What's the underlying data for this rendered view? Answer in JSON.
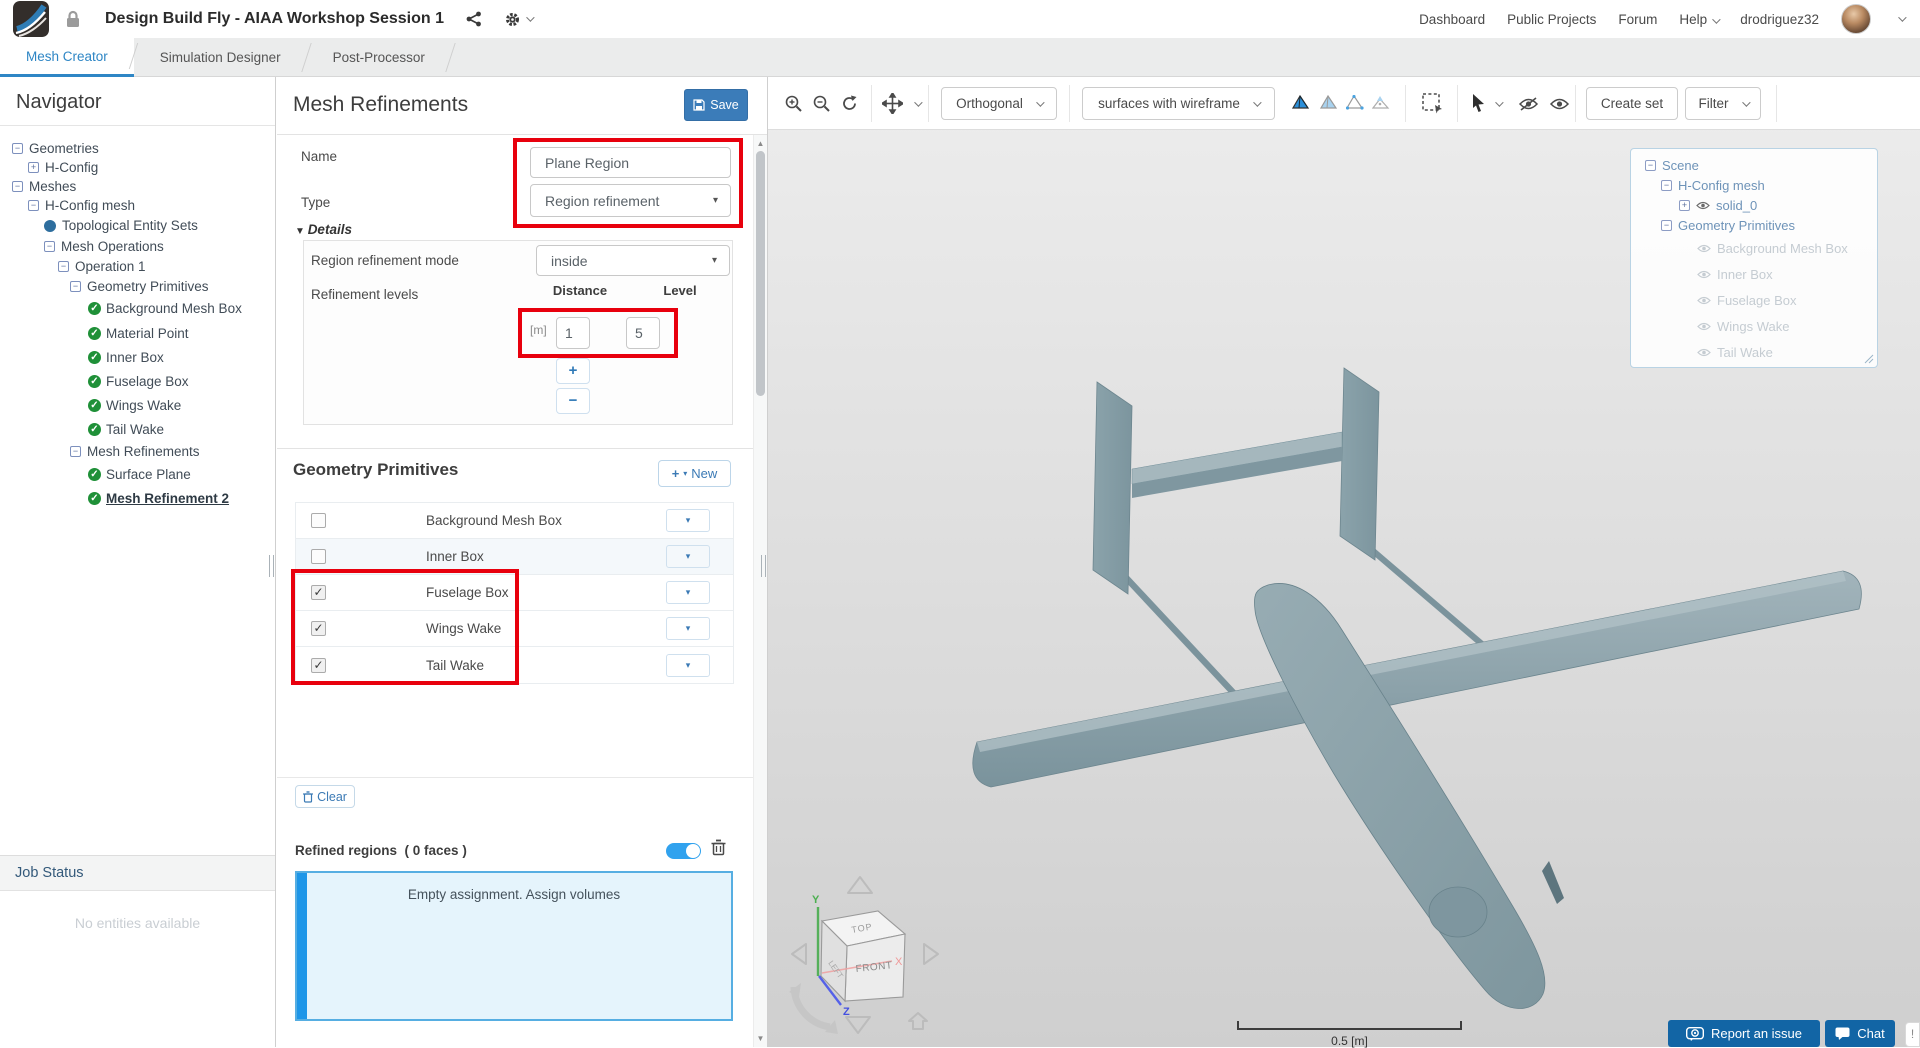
{
  "header": {
    "title": "Design Build Fly - AIAA Workshop Session 1",
    "nav": {
      "dashboard": "Dashboard",
      "public_projects": "Public Projects",
      "forum": "Forum",
      "help": "Help",
      "username": "drodriguez32"
    }
  },
  "tabs": [
    {
      "label": "Mesh Creator",
      "active": true
    },
    {
      "label": "Simulation Designer",
      "active": false
    },
    {
      "label": "Post-Processor",
      "active": false
    }
  ],
  "navigator": {
    "title": "Navigator",
    "tree": [
      {
        "label": "Geometries",
        "icon": "collapse"
      },
      {
        "label": "H-Config",
        "icon": "expand"
      },
      {
        "label": "Meshes",
        "icon": "collapse"
      },
      {
        "label": "H-Config mesh",
        "icon": "collapse"
      },
      {
        "label": "Topological Entity Sets",
        "icon": "blue-dot"
      },
      {
        "label": "Mesh Operations",
        "icon": "collapse"
      },
      {
        "label": "Operation 1",
        "icon": "collapse"
      },
      {
        "label": "Geometry Primitives",
        "icon": "collapse"
      },
      {
        "label": "Background Mesh Box",
        "icon": "check"
      },
      {
        "label": "Material Point",
        "icon": "check"
      },
      {
        "label": "Inner Box",
        "icon": "check"
      },
      {
        "label": "Fuselage Box",
        "icon": "check"
      },
      {
        "label": "Wings Wake",
        "icon": "check"
      },
      {
        "label": "Tail Wake",
        "icon": "check"
      },
      {
        "label": "Mesh Refinements",
        "icon": "collapse"
      },
      {
        "label": "Surface Plane",
        "icon": "check"
      },
      {
        "label": "Mesh Refinement 2",
        "icon": "check",
        "selected": true
      }
    ],
    "job_status": {
      "title": "Job Status",
      "empty_message": "No entities available"
    }
  },
  "panel": {
    "title": "Mesh Refinements",
    "save_label": "Save",
    "name_label": "Name",
    "name_value": "Plane Region",
    "type_label": "Type",
    "type_value": "Region refinement",
    "details_label": "Details",
    "mode_label": "Region refinement mode",
    "mode_value": "inside",
    "levels_label": "Refinement levels",
    "distance_header": "Distance",
    "level_header": "Level",
    "unit_label": "[m]",
    "distance_value": "1",
    "level_value": "5",
    "add_level_label": "+",
    "remove_level_label": "−",
    "primitives": {
      "title": "Geometry Primitives",
      "new_button": "New",
      "rows": [
        {
          "label": "Background Mesh Box",
          "checked": false
        },
        {
          "label": "Inner Box",
          "checked": false
        },
        {
          "label": "Fuselage Box",
          "checked": true
        },
        {
          "label": "Wings Wake",
          "checked": true
        },
        {
          "label": "Tail Wake",
          "checked": true
        }
      ]
    },
    "clear_label": "Clear",
    "refined_regions": {
      "label": "Refined regions",
      "count": "( 0 faces )",
      "toggle_on": true,
      "empty_message": "Empty assignment. Assign volumes"
    }
  },
  "viewport": {
    "toolbar": {
      "projection": "Orthogonal",
      "render_mode": "surfaces with wireframe",
      "create_set": "Create set",
      "filter": "Filter"
    },
    "scene_tree": {
      "items": [
        {
          "label": "Scene"
        },
        {
          "label": "H-Config mesh"
        },
        {
          "label": "solid_0"
        },
        {
          "label": "Geometry Primitives"
        },
        {
          "label": "Background Mesh Box",
          "dim": true
        },
        {
          "label": "Inner Box",
          "dim": true
        },
        {
          "label": "Fuselage Box",
          "dim": true
        },
        {
          "label": "Wings Wake",
          "dim": true
        },
        {
          "label": "Tail Wake",
          "dim": true
        }
      ]
    },
    "nav_cube": {
      "top": "TOP",
      "front": "FRONT",
      "left": "LEFT",
      "axis_x": "X",
      "axis_y": "Y",
      "axis_z": "Z"
    },
    "scale_label": "0.5 [m]",
    "report_button": "Report an issue",
    "chat_button": "Chat",
    "alert_badge": "!"
  },
  "colors": {
    "accent_blue": "#2e86c5",
    "save_blue": "#3b7cb9",
    "annotation_red": "#e8000d",
    "toggle_blue": "#31a2ee",
    "assignment_blue": "#1e96e8",
    "model_gray": "#8aa3ab"
  }
}
